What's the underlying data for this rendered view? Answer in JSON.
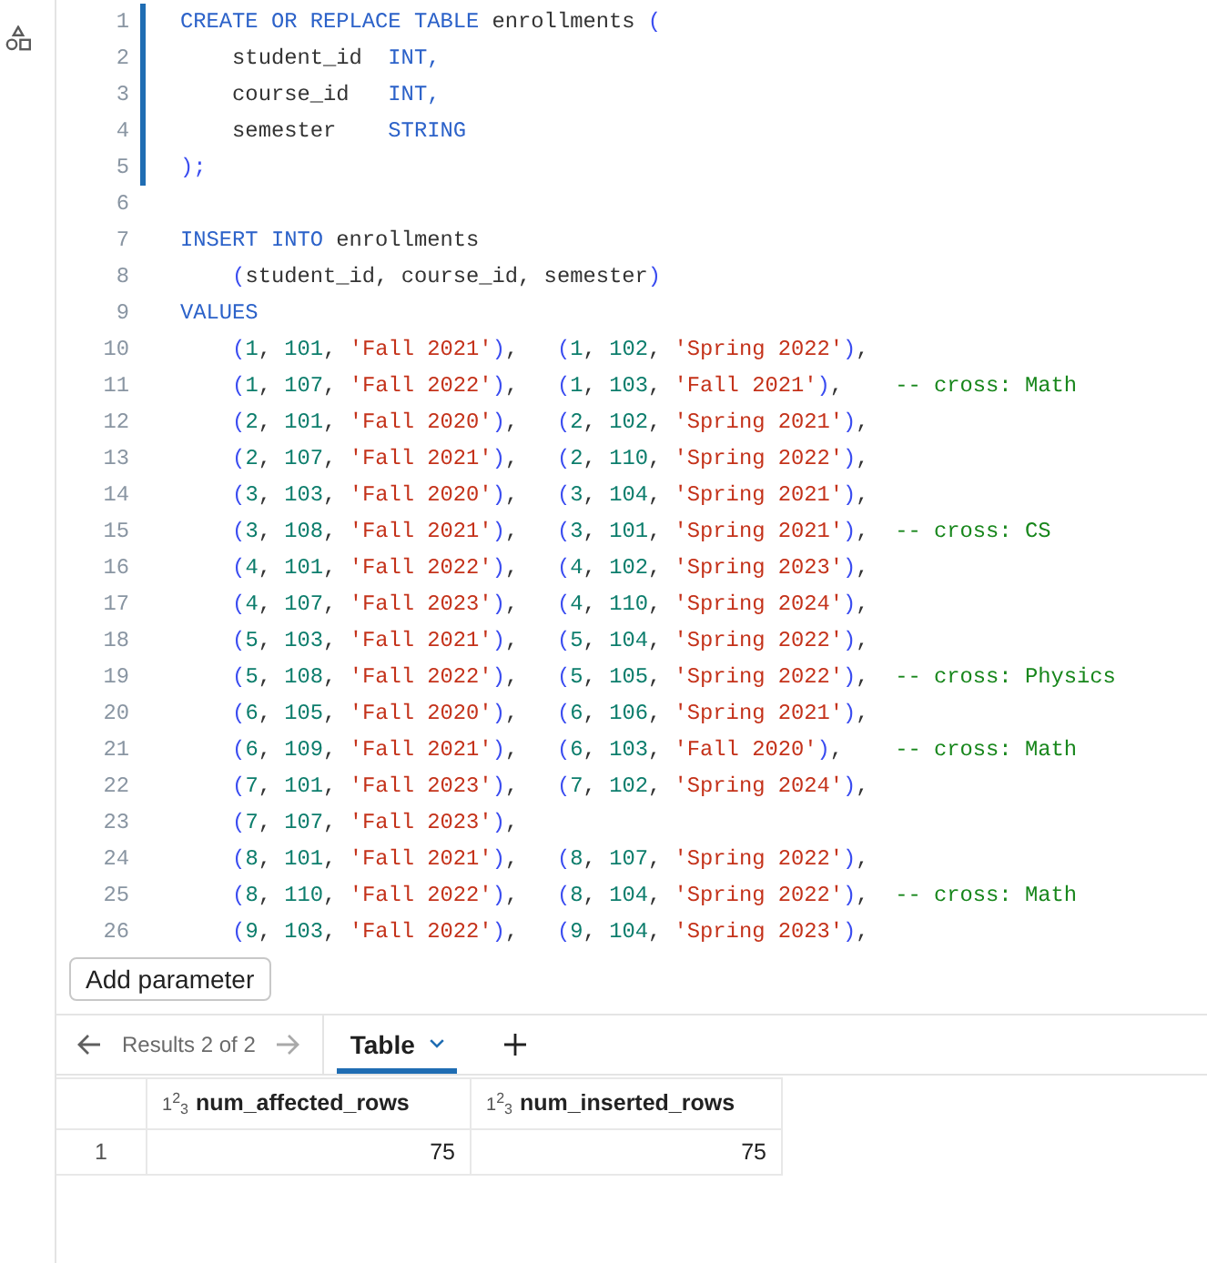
{
  "editor": {
    "lines": [
      {
        "number": "1",
        "modified": true,
        "tokens": [
          {
            "kind": "keyword",
            "text": "CREATE OR REPLACE TABLE"
          },
          {
            "kind": "plain",
            "text": " enrollments "
          },
          {
            "kind": "paren",
            "text": "("
          }
        ]
      },
      {
        "number": "2",
        "modified": true,
        "tokens": [
          {
            "kind": "plain",
            "text": "    student_id  "
          },
          {
            "kind": "keyword",
            "text": "INT,"
          }
        ]
      },
      {
        "number": "3",
        "modified": true,
        "tokens": [
          {
            "kind": "plain",
            "text": "    course_id   "
          },
          {
            "kind": "keyword",
            "text": "INT,"
          }
        ]
      },
      {
        "number": "4",
        "modified": true,
        "tokens": [
          {
            "kind": "plain",
            "text": "    semester    "
          },
          {
            "kind": "keyword",
            "text": "STRING"
          }
        ]
      },
      {
        "number": "5",
        "modified": true,
        "tokens": [
          {
            "kind": "paren",
            "text": ");"
          }
        ]
      },
      {
        "number": "6",
        "modified": false
      },
      {
        "number": "7",
        "modified": false,
        "tokens": [
          {
            "kind": "keyword",
            "text": "INSERT INTO"
          },
          {
            "kind": "plain",
            "text": " enrollments"
          }
        ]
      },
      {
        "number": "8",
        "modified": false,
        "tokens": [
          {
            "kind": "paren",
            "text": "    ("
          },
          {
            "kind": "plain",
            "text": "student_id, course_id, semester"
          },
          {
            "kind": "paren",
            "text": ")"
          }
        ]
      },
      {
        "number": "9",
        "modified": false,
        "tokens": [
          {
            "kind": "keyword",
            "text": "VALUES"
          }
        ]
      },
      {
        "number": "10",
        "modified": false,
        "tokens": [
          {
            "kind": "paren",
            "text": "    ("
          },
          {
            "kind": "number",
            "text": "1"
          },
          {
            "kind": "plain",
            "text": ", "
          },
          {
            "kind": "number",
            "text": "101"
          },
          {
            "kind": "plain",
            "text": ", "
          },
          {
            "kind": "string",
            "text": "'Fall 2021'"
          },
          {
            "kind": "paren",
            "text": ")"
          },
          {
            "kind": "plain",
            "text": ",   "
          },
          {
            "kind": "paren",
            "text": "("
          },
          {
            "kind": "number",
            "text": "1"
          },
          {
            "kind": "plain",
            "text": ", "
          },
          {
            "kind": "number",
            "text": "102"
          },
          {
            "kind": "plain",
            "text": ", "
          },
          {
            "kind": "string",
            "text": "'Spring 2022'"
          },
          {
            "kind": "paren",
            "text": ")"
          },
          {
            "kind": "plain",
            "text": ","
          }
        ]
      },
      {
        "number": "11",
        "modified": false,
        "tokens": [
          {
            "kind": "paren",
            "text": "    ("
          },
          {
            "kind": "number",
            "text": "1"
          },
          {
            "kind": "plain",
            "text": ", "
          },
          {
            "kind": "number",
            "text": "107"
          },
          {
            "kind": "plain",
            "text": ", "
          },
          {
            "kind": "string",
            "text": "'Fall 2022'"
          },
          {
            "kind": "paren",
            "text": ")"
          },
          {
            "kind": "plain",
            "text": ",   "
          },
          {
            "kind": "paren",
            "text": "("
          },
          {
            "kind": "number",
            "text": "1"
          },
          {
            "kind": "plain",
            "text": ", "
          },
          {
            "kind": "number",
            "text": "103"
          },
          {
            "kind": "plain",
            "text": ", "
          },
          {
            "kind": "string",
            "text": "'Fall 2021'"
          },
          {
            "kind": "paren",
            "text": ")"
          },
          {
            "kind": "plain",
            "text": ",    "
          },
          {
            "kind": "comment",
            "text": "-- cross: Math"
          }
        ]
      },
      {
        "number": "12",
        "modified": false,
        "tokens": [
          {
            "kind": "paren",
            "text": "    ("
          },
          {
            "kind": "number",
            "text": "2"
          },
          {
            "kind": "plain",
            "text": ", "
          },
          {
            "kind": "number",
            "text": "101"
          },
          {
            "kind": "plain",
            "text": ", "
          },
          {
            "kind": "string",
            "text": "'Fall 2020'"
          },
          {
            "kind": "paren",
            "text": ")"
          },
          {
            "kind": "plain",
            "text": ",   "
          },
          {
            "kind": "paren",
            "text": "("
          },
          {
            "kind": "number",
            "text": "2"
          },
          {
            "kind": "plain",
            "text": ", "
          },
          {
            "kind": "number",
            "text": "102"
          },
          {
            "kind": "plain",
            "text": ", "
          },
          {
            "kind": "string",
            "text": "'Spring 2021'"
          },
          {
            "kind": "paren",
            "text": ")"
          },
          {
            "kind": "plain",
            "text": ","
          }
        ]
      },
      {
        "number": "13",
        "modified": false,
        "tokens": [
          {
            "kind": "paren",
            "text": "    ("
          },
          {
            "kind": "number",
            "text": "2"
          },
          {
            "kind": "plain",
            "text": ", "
          },
          {
            "kind": "number",
            "text": "107"
          },
          {
            "kind": "plain",
            "text": ", "
          },
          {
            "kind": "string",
            "text": "'Fall 2021'"
          },
          {
            "kind": "paren",
            "text": ")"
          },
          {
            "kind": "plain",
            "text": ",   "
          },
          {
            "kind": "paren",
            "text": "("
          },
          {
            "kind": "number",
            "text": "2"
          },
          {
            "kind": "plain",
            "text": ", "
          },
          {
            "kind": "number",
            "text": "110"
          },
          {
            "kind": "plain",
            "text": ", "
          },
          {
            "kind": "string",
            "text": "'Spring 2022'"
          },
          {
            "kind": "paren",
            "text": ")"
          },
          {
            "kind": "plain",
            "text": ","
          }
        ]
      },
      {
        "number": "14",
        "modified": false,
        "tokens": [
          {
            "kind": "paren",
            "text": "    ("
          },
          {
            "kind": "number",
            "text": "3"
          },
          {
            "kind": "plain",
            "text": ", "
          },
          {
            "kind": "number",
            "text": "103"
          },
          {
            "kind": "plain",
            "text": ", "
          },
          {
            "kind": "string",
            "text": "'Fall 2020'"
          },
          {
            "kind": "paren",
            "text": ")"
          },
          {
            "kind": "plain",
            "text": ",   "
          },
          {
            "kind": "paren",
            "text": "("
          },
          {
            "kind": "number",
            "text": "3"
          },
          {
            "kind": "plain",
            "text": ", "
          },
          {
            "kind": "number",
            "text": "104"
          },
          {
            "kind": "plain",
            "text": ", "
          },
          {
            "kind": "string",
            "text": "'Spring 2021'"
          },
          {
            "kind": "paren",
            "text": ")"
          },
          {
            "kind": "plain",
            "text": ","
          }
        ]
      },
      {
        "number": "15",
        "modified": false,
        "tokens": [
          {
            "kind": "paren",
            "text": "    ("
          },
          {
            "kind": "number",
            "text": "3"
          },
          {
            "kind": "plain",
            "text": ", "
          },
          {
            "kind": "number",
            "text": "108"
          },
          {
            "kind": "plain",
            "text": ", "
          },
          {
            "kind": "string",
            "text": "'Fall 2021'"
          },
          {
            "kind": "paren",
            "text": ")"
          },
          {
            "kind": "plain",
            "text": ",   "
          },
          {
            "kind": "paren",
            "text": "("
          },
          {
            "kind": "number",
            "text": "3"
          },
          {
            "kind": "plain",
            "text": ", "
          },
          {
            "kind": "number",
            "text": "101"
          },
          {
            "kind": "plain",
            "text": ", "
          },
          {
            "kind": "string",
            "text": "'Spring 2021'"
          },
          {
            "kind": "paren",
            "text": ")"
          },
          {
            "kind": "plain",
            "text": ",  "
          },
          {
            "kind": "comment",
            "text": "-- cross: CS"
          }
        ]
      },
      {
        "number": "16",
        "modified": false,
        "tokens": [
          {
            "kind": "paren",
            "text": "    ("
          },
          {
            "kind": "number",
            "text": "4"
          },
          {
            "kind": "plain",
            "text": ", "
          },
          {
            "kind": "number",
            "text": "101"
          },
          {
            "kind": "plain",
            "text": ", "
          },
          {
            "kind": "string",
            "text": "'Fall 2022'"
          },
          {
            "kind": "paren",
            "text": ")"
          },
          {
            "kind": "plain",
            "text": ",   "
          },
          {
            "kind": "paren",
            "text": "("
          },
          {
            "kind": "number",
            "text": "4"
          },
          {
            "kind": "plain",
            "text": ", "
          },
          {
            "kind": "number",
            "text": "102"
          },
          {
            "kind": "plain",
            "text": ", "
          },
          {
            "kind": "string",
            "text": "'Spring 2023'"
          },
          {
            "kind": "paren",
            "text": ")"
          },
          {
            "kind": "plain",
            "text": ","
          }
        ]
      },
      {
        "number": "17",
        "modified": false,
        "tokens": [
          {
            "kind": "paren",
            "text": "    ("
          },
          {
            "kind": "number",
            "text": "4"
          },
          {
            "kind": "plain",
            "text": ", "
          },
          {
            "kind": "number",
            "text": "107"
          },
          {
            "kind": "plain",
            "text": ", "
          },
          {
            "kind": "string",
            "text": "'Fall 2023'"
          },
          {
            "kind": "paren",
            "text": ")"
          },
          {
            "kind": "plain",
            "text": ",   "
          },
          {
            "kind": "paren",
            "text": "("
          },
          {
            "kind": "number",
            "text": "4"
          },
          {
            "kind": "plain",
            "text": ", "
          },
          {
            "kind": "number",
            "text": "110"
          },
          {
            "kind": "plain",
            "text": ", "
          },
          {
            "kind": "string",
            "text": "'Spring 2024'"
          },
          {
            "kind": "paren",
            "text": ")"
          },
          {
            "kind": "plain",
            "text": ","
          }
        ]
      },
      {
        "number": "18",
        "modified": false,
        "tokens": [
          {
            "kind": "paren",
            "text": "    ("
          },
          {
            "kind": "number",
            "text": "5"
          },
          {
            "kind": "plain",
            "text": ", "
          },
          {
            "kind": "number",
            "text": "103"
          },
          {
            "kind": "plain",
            "text": ", "
          },
          {
            "kind": "string",
            "text": "'Fall 2021'"
          },
          {
            "kind": "paren",
            "text": ")"
          },
          {
            "kind": "plain",
            "text": ",   "
          },
          {
            "kind": "paren",
            "text": "("
          },
          {
            "kind": "number",
            "text": "5"
          },
          {
            "kind": "plain",
            "text": ", "
          },
          {
            "kind": "number",
            "text": "104"
          },
          {
            "kind": "plain",
            "text": ", "
          },
          {
            "kind": "string",
            "text": "'Spring 2022'"
          },
          {
            "kind": "paren",
            "text": ")"
          },
          {
            "kind": "plain",
            "text": ","
          }
        ]
      },
      {
        "number": "19",
        "modified": false,
        "tokens": [
          {
            "kind": "paren",
            "text": "    ("
          },
          {
            "kind": "number",
            "text": "5"
          },
          {
            "kind": "plain",
            "text": ", "
          },
          {
            "kind": "number",
            "text": "108"
          },
          {
            "kind": "plain",
            "text": ", "
          },
          {
            "kind": "string",
            "text": "'Fall 2022'"
          },
          {
            "kind": "paren",
            "text": ")"
          },
          {
            "kind": "plain",
            "text": ",   "
          },
          {
            "kind": "paren",
            "text": "("
          },
          {
            "kind": "number",
            "text": "5"
          },
          {
            "kind": "plain",
            "text": ", "
          },
          {
            "kind": "number",
            "text": "105"
          },
          {
            "kind": "plain",
            "text": ", "
          },
          {
            "kind": "string",
            "text": "'Spring 2022'"
          },
          {
            "kind": "paren",
            "text": ")"
          },
          {
            "kind": "plain",
            "text": ",  "
          },
          {
            "kind": "comment",
            "text": "-- cross: Physics"
          }
        ]
      },
      {
        "number": "20",
        "modified": false,
        "tokens": [
          {
            "kind": "paren",
            "text": "    ("
          },
          {
            "kind": "number",
            "text": "6"
          },
          {
            "kind": "plain",
            "text": ", "
          },
          {
            "kind": "number",
            "text": "105"
          },
          {
            "kind": "plain",
            "text": ", "
          },
          {
            "kind": "string",
            "text": "'Fall 2020'"
          },
          {
            "kind": "paren",
            "text": ")"
          },
          {
            "kind": "plain",
            "text": ",   "
          },
          {
            "kind": "paren",
            "text": "("
          },
          {
            "kind": "number",
            "text": "6"
          },
          {
            "kind": "plain",
            "text": ", "
          },
          {
            "kind": "number",
            "text": "106"
          },
          {
            "kind": "plain",
            "text": ", "
          },
          {
            "kind": "string",
            "text": "'Spring 2021'"
          },
          {
            "kind": "paren",
            "text": ")"
          },
          {
            "kind": "plain",
            "text": ","
          }
        ]
      },
      {
        "number": "21",
        "modified": false,
        "tokens": [
          {
            "kind": "paren",
            "text": "    ("
          },
          {
            "kind": "number",
            "text": "6"
          },
          {
            "kind": "plain",
            "text": ", "
          },
          {
            "kind": "number",
            "text": "109"
          },
          {
            "kind": "plain",
            "text": ", "
          },
          {
            "kind": "string",
            "text": "'Fall 2021'"
          },
          {
            "kind": "paren",
            "text": ")"
          },
          {
            "kind": "plain",
            "text": ",   "
          },
          {
            "kind": "paren",
            "text": "("
          },
          {
            "kind": "number",
            "text": "6"
          },
          {
            "kind": "plain",
            "text": ", "
          },
          {
            "kind": "number",
            "text": "103"
          },
          {
            "kind": "plain",
            "text": ", "
          },
          {
            "kind": "string",
            "text": "'Fall 2020'"
          },
          {
            "kind": "paren",
            "text": ")"
          },
          {
            "kind": "plain",
            "text": ",    "
          },
          {
            "kind": "comment",
            "text": "-- cross: Math"
          }
        ]
      },
      {
        "number": "22",
        "modified": false,
        "tokens": [
          {
            "kind": "paren",
            "text": "    ("
          },
          {
            "kind": "number",
            "text": "7"
          },
          {
            "kind": "plain",
            "text": ", "
          },
          {
            "kind": "number",
            "text": "101"
          },
          {
            "kind": "plain",
            "text": ", "
          },
          {
            "kind": "string",
            "text": "'Fall 2023'"
          },
          {
            "kind": "paren",
            "text": ")"
          },
          {
            "kind": "plain",
            "text": ",   "
          },
          {
            "kind": "paren",
            "text": "("
          },
          {
            "kind": "number",
            "text": "7"
          },
          {
            "kind": "plain",
            "text": ", "
          },
          {
            "kind": "number",
            "text": "102"
          },
          {
            "kind": "plain",
            "text": ", "
          },
          {
            "kind": "string",
            "text": "'Spring 2024'"
          },
          {
            "kind": "paren",
            "text": ")"
          },
          {
            "kind": "plain",
            "text": ","
          }
        ]
      },
      {
        "number": "23",
        "modified": false,
        "tokens": [
          {
            "kind": "paren",
            "text": "    ("
          },
          {
            "kind": "number",
            "text": "7"
          },
          {
            "kind": "plain",
            "text": ", "
          },
          {
            "kind": "number",
            "text": "107"
          },
          {
            "kind": "plain",
            "text": ", "
          },
          {
            "kind": "string",
            "text": "'Fall 2023'"
          },
          {
            "kind": "paren",
            "text": ")"
          },
          {
            "kind": "plain",
            "text": ","
          }
        ]
      },
      {
        "number": "24",
        "modified": false,
        "tokens": [
          {
            "kind": "paren",
            "text": "    ("
          },
          {
            "kind": "number",
            "text": "8"
          },
          {
            "kind": "plain",
            "text": ", "
          },
          {
            "kind": "number",
            "text": "101"
          },
          {
            "kind": "plain",
            "text": ", "
          },
          {
            "kind": "string",
            "text": "'Fall 2021'"
          },
          {
            "kind": "paren",
            "text": ")"
          },
          {
            "kind": "plain",
            "text": ",   "
          },
          {
            "kind": "paren",
            "text": "("
          },
          {
            "kind": "number",
            "text": "8"
          },
          {
            "kind": "plain",
            "text": ", "
          },
          {
            "kind": "number",
            "text": "107"
          },
          {
            "kind": "plain",
            "text": ", "
          },
          {
            "kind": "string",
            "text": "'Spring 2022'"
          },
          {
            "kind": "paren",
            "text": ")"
          },
          {
            "kind": "plain",
            "text": ","
          }
        ]
      },
      {
        "number": "25",
        "modified": false,
        "tokens": [
          {
            "kind": "paren",
            "text": "    ("
          },
          {
            "kind": "number",
            "text": "8"
          },
          {
            "kind": "plain",
            "text": ", "
          },
          {
            "kind": "number",
            "text": "110"
          },
          {
            "kind": "plain",
            "text": ", "
          },
          {
            "kind": "string",
            "text": "'Fall 2022'"
          },
          {
            "kind": "paren",
            "text": ")"
          },
          {
            "kind": "plain",
            "text": ",   "
          },
          {
            "kind": "paren",
            "text": "("
          },
          {
            "kind": "number",
            "text": "8"
          },
          {
            "kind": "plain",
            "text": ", "
          },
          {
            "kind": "number",
            "text": "104"
          },
          {
            "kind": "plain",
            "text": ", "
          },
          {
            "kind": "string",
            "text": "'Spring 2022'"
          },
          {
            "kind": "paren",
            "text": ")"
          },
          {
            "kind": "plain",
            "text": ",  "
          },
          {
            "kind": "comment",
            "text": "-- cross: Math"
          }
        ]
      },
      {
        "number": "26",
        "modified": false,
        "tokens": [
          {
            "kind": "paren",
            "text": "    ("
          },
          {
            "kind": "number",
            "text": "9"
          },
          {
            "kind": "plain",
            "text": ", "
          },
          {
            "kind": "number",
            "text": "103"
          },
          {
            "kind": "plain",
            "text": ", "
          },
          {
            "kind": "string",
            "text": "'Fall 2022'"
          },
          {
            "kind": "paren",
            "text": ")"
          },
          {
            "kind": "plain",
            "text": ",   "
          },
          {
            "kind": "paren",
            "text": "("
          },
          {
            "kind": "number",
            "text": "9"
          },
          {
            "kind": "plain",
            "text": ", "
          },
          {
            "kind": "number",
            "text": "104"
          },
          {
            "kind": "plain",
            "text": ", "
          },
          {
            "kind": "string",
            "text": "'Spring 2023'"
          },
          {
            "kind": "paren",
            "text": ")"
          },
          {
            "kind": "plain",
            "text": ","
          }
        ]
      }
    ]
  },
  "add_parameter_button": {
    "label": "Add parameter"
  },
  "results": {
    "navigator": {
      "label": "Results 2 of 2",
      "previous_disabled": false,
      "next_disabled": true
    },
    "tabs": [
      {
        "label": "Table",
        "selected": true
      }
    ],
    "table": {
      "columns": [
        {
          "type_badge": "1$^{2}$$_{3}$",
          "label": "num_affected_rows"
        },
        {
          "type_badge": "1$^{2}$$_{3}$",
          "label": "num_inserted_rows"
        }
      ],
      "rows": [
        {
          "index": "1",
          "cells": [
            "75",
            "75"
          ]
        }
      ]
    }
  }
}
